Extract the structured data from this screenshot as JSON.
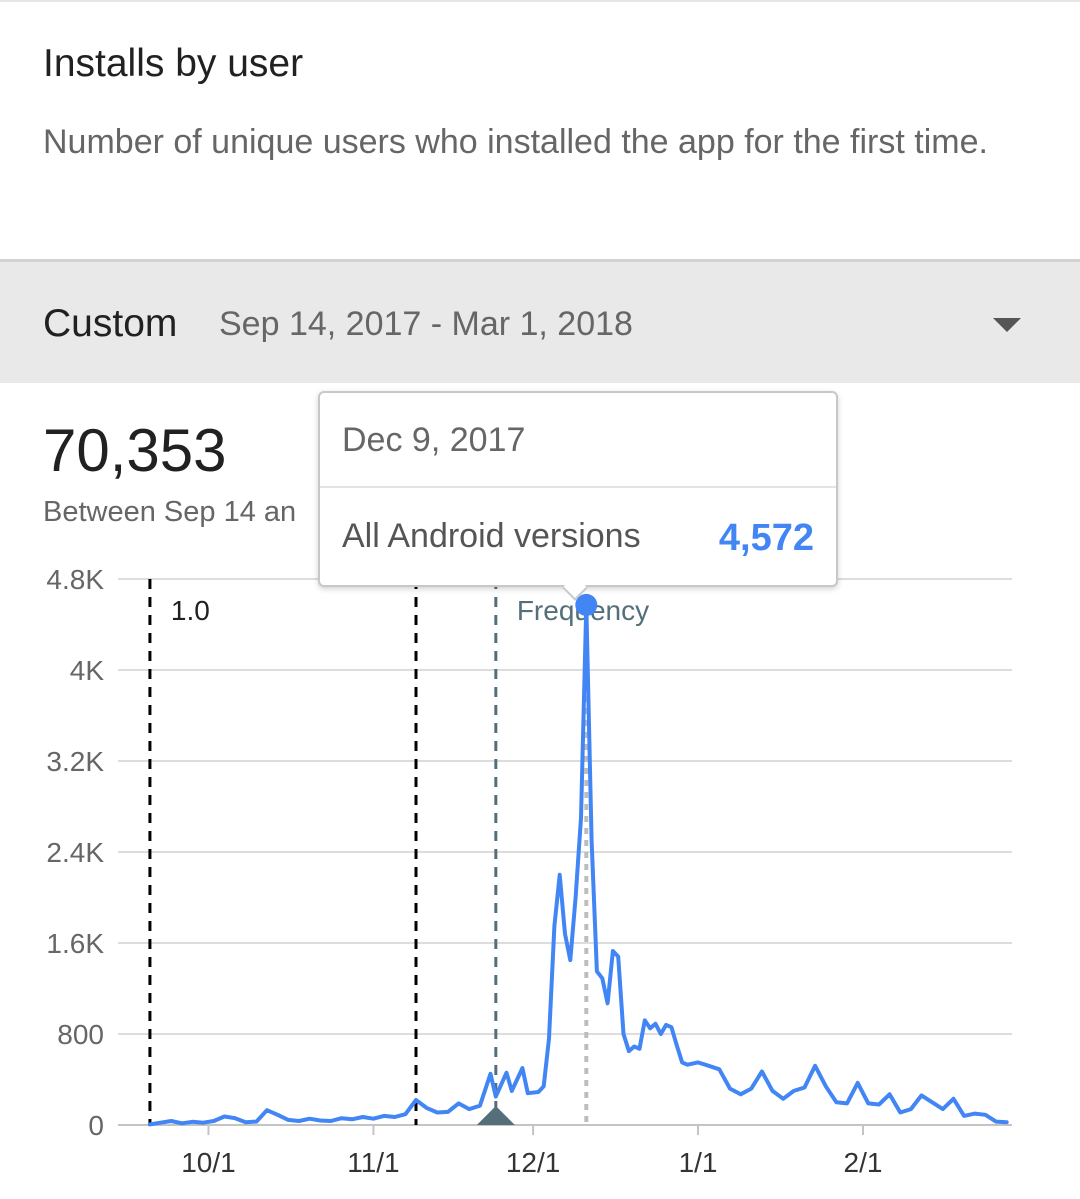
{
  "header": {
    "title": "Installs by user",
    "description": "Number of unique users who installed the app for the first time."
  },
  "filter": {
    "label": "Custom",
    "range": "Sep 14, 2017 - Mar 1, 2018",
    "dropdown_icon": "chevron-down-icon"
  },
  "summary": {
    "total": "70,353",
    "subtitle": "Between Sep 14 an"
  },
  "tooltip": {
    "date": "Dec 9, 2017",
    "series": "All Android versions",
    "value": "4,572"
  },
  "colors": {
    "line": "#4285f4",
    "annotation_version": "#000000",
    "annotation_event": "#546e7a",
    "cursor": "#bdbdbd",
    "grid": "#dddddd"
  },
  "chart_data": {
    "type": "line",
    "x_axis": {
      "start": "2017-09-14",
      "end": "2018-03-01",
      "ticks": [
        "10/1",
        "11/1",
        "12/1",
        "1/1",
        "2/1"
      ],
      "tick_dates": [
        "2017-10-01",
        "2017-11-01",
        "2017-12-01",
        "2018-01-01",
        "2018-02-01"
      ]
    },
    "y_axis": {
      "min": 0,
      "max": 4800,
      "ticks": [
        0,
        800,
        1600,
        2400,
        3200,
        4000,
        4800
      ],
      "tick_labels": [
        "0",
        "800",
        "1.6K",
        "2.4K",
        "3.2K",
        "4K",
        "4.8K"
      ]
    },
    "grid": true,
    "series": [
      {
        "name": "All Android versions",
        "points": [
          [
            "2017-09-20",
            5
          ],
          [
            "2017-09-22",
            20
          ],
          [
            "2017-09-24",
            35
          ],
          [
            "2017-09-26",
            15
          ],
          [
            "2017-09-28",
            28
          ],
          [
            "2017-09-30",
            20
          ],
          [
            "2017-10-02",
            35
          ],
          [
            "2017-10-04",
            75
          ],
          [
            "2017-10-06",
            60
          ],
          [
            "2017-10-08",
            25
          ],
          [
            "2017-10-10",
            30
          ],
          [
            "2017-10-12",
            130
          ],
          [
            "2017-10-14",
            90
          ],
          [
            "2017-10-16",
            45
          ],
          [
            "2017-10-18",
            35
          ],
          [
            "2017-10-20",
            55
          ],
          [
            "2017-10-22",
            40
          ],
          [
            "2017-10-24",
            35
          ],
          [
            "2017-10-26",
            60
          ],
          [
            "2017-10-28",
            50
          ],
          [
            "2017-10-30",
            70
          ],
          [
            "2017-11-01",
            55
          ],
          [
            "2017-11-03",
            80
          ],
          [
            "2017-11-05",
            70
          ],
          [
            "2017-11-07",
            95
          ],
          [
            "2017-11-09",
            220
          ],
          [
            "2017-11-11",
            150
          ],
          [
            "2017-11-13",
            110
          ],
          [
            "2017-11-15",
            115
          ],
          [
            "2017-11-17",
            190
          ],
          [
            "2017-11-19",
            140
          ],
          [
            "2017-11-21",
            170
          ],
          [
            "2017-11-23",
            450
          ],
          [
            "2017-11-24",
            250
          ],
          [
            "2017-11-26",
            460
          ],
          [
            "2017-11-27",
            300
          ],
          [
            "2017-11-29",
            500
          ],
          [
            "2017-11-30",
            280
          ],
          [
            "2017-12-02",
            290
          ],
          [
            "2017-12-03",
            340
          ],
          [
            "2017-12-04",
            760
          ],
          [
            "2017-12-05",
            1750
          ],
          [
            "2017-12-06",
            2200
          ],
          [
            "2017-12-07",
            1680
          ],
          [
            "2017-12-08",
            1450
          ],
          [
            "2017-12-09",
            2000
          ],
          [
            "2017-12-10",
            2700
          ],
          [
            "2017-12-11",
            4572
          ],
          [
            "2017-12-12",
            2500
          ],
          [
            "2017-12-13",
            1350
          ],
          [
            "2017-12-14",
            1290
          ],
          [
            "2017-12-15",
            1070
          ],
          [
            "2017-12-16",
            1530
          ],
          [
            "2017-12-17",
            1480
          ],
          [
            "2017-12-18",
            800
          ],
          [
            "2017-12-19",
            650
          ],
          [
            "2017-12-20",
            690
          ],
          [
            "2017-12-21",
            670
          ],
          [
            "2017-12-22",
            920
          ],
          [
            "2017-12-23",
            850
          ],
          [
            "2017-12-24",
            890
          ],
          [
            "2017-12-25",
            800
          ],
          [
            "2017-12-26",
            880
          ],
          [
            "2017-12-27",
            860
          ],
          [
            "2017-12-28",
            700
          ],
          [
            "2017-12-29",
            550
          ],
          [
            "2017-12-30",
            530
          ],
          [
            "2018-01-01",
            550
          ],
          [
            "2018-01-03",
            520
          ],
          [
            "2018-01-05",
            490
          ],
          [
            "2018-01-07",
            320
          ],
          [
            "2018-01-09",
            270
          ],
          [
            "2018-01-11",
            320
          ],
          [
            "2018-01-13",
            470
          ],
          [
            "2018-01-15",
            300
          ],
          [
            "2018-01-17",
            230
          ],
          [
            "2018-01-19",
            300
          ],
          [
            "2018-01-21",
            330
          ],
          [
            "2018-01-23",
            520
          ],
          [
            "2018-01-25",
            340
          ],
          [
            "2018-01-27",
            200
          ],
          [
            "2018-01-29",
            190
          ],
          [
            "2018-01-31",
            370
          ],
          [
            "2018-02-02",
            190
          ],
          [
            "2018-02-04",
            180
          ],
          [
            "2018-02-06",
            270
          ],
          [
            "2018-02-08",
            110
          ],
          [
            "2018-02-10",
            140
          ],
          [
            "2018-02-12",
            260
          ],
          [
            "2018-02-14",
            200
          ],
          [
            "2018-02-16",
            140
          ],
          [
            "2018-02-18",
            230
          ],
          [
            "2018-02-20",
            80
          ],
          [
            "2018-02-22",
            100
          ],
          [
            "2018-02-24",
            90
          ],
          [
            "2018-02-26",
            30
          ],
          [
            "2018-02-28",
            25
          ]
        ]
      }
    ],
    "annotations": [
      {
        "date": "2017-09-20",
        "label": "1.0",
        "style": "dashed",
        "color": "#000000"
      },
      {
        "date": "2017-11-09",
        "label": "",
        "style": "dashed",
        "color": "#000000"
      },
      {
        "date": "2017-11-24",
        "label": "Frequency",
        "style": "dashed",
        "color": "#546e7a",
        "marker": "triangle"
      },
      {
        "date": "2017-12-11",
        "label": "",
        "style": "dotted",
        "color": "#bdbdbd",
        "role": "cursor"
      }
    ],
    "highlight": {
      "date": "2017-12-11",
      "value": 4572
    }
  }
}
